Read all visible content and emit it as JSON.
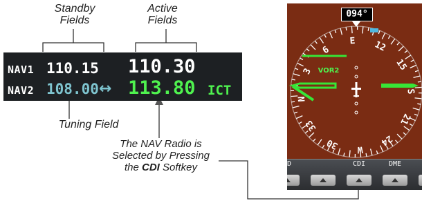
{
  "labels": {
    "standby_line1": "Standby",
    "standby_line2": "Fields",
    "active_line1": "Active",
    "active_line2": "Fields",
    "tuning": "Tuning Field",
    "cdi_line1": "The NAV Radio is",
    "cdi_line2": "Selected by Pressing",
    "cdi_line3_pre": "the ",
    "cdi_line3_bold": "CDI",
    "cdi_line3_post": " Softkey"
  },
  "nav": {
    "nav1": {
      "id": "NAV1",
      "standby": "110.15",
      "active": "110.30"
    },
    "nav2": {
      "id": "NAV2",
      "standby": "108.00",
      "active": "113.80",
      "ident": "ICT"
    },
    "swap_symbol": "↔"
  },
  "hsi": {
    "heading": "094°",
    "source": "VOR2",
    "compass_labels": [
      "E",
      "12",
      "15",
      "S",
      "21",
      "24",
      "W",
      "30",
      "33",
      "N",
      "3",
      "6"
    ]
  },
  "softkeys": [
    "FD",
    "",
    "CDI",
    "DME",
    ""
  ],
  "colors": {
    "nav_bg": "#1d2023",
    "standby_cyan": "#7ec4cf",
    "active_green": "#4ff24f",
    "panel_brown": "#7a2c13"
  }
}
